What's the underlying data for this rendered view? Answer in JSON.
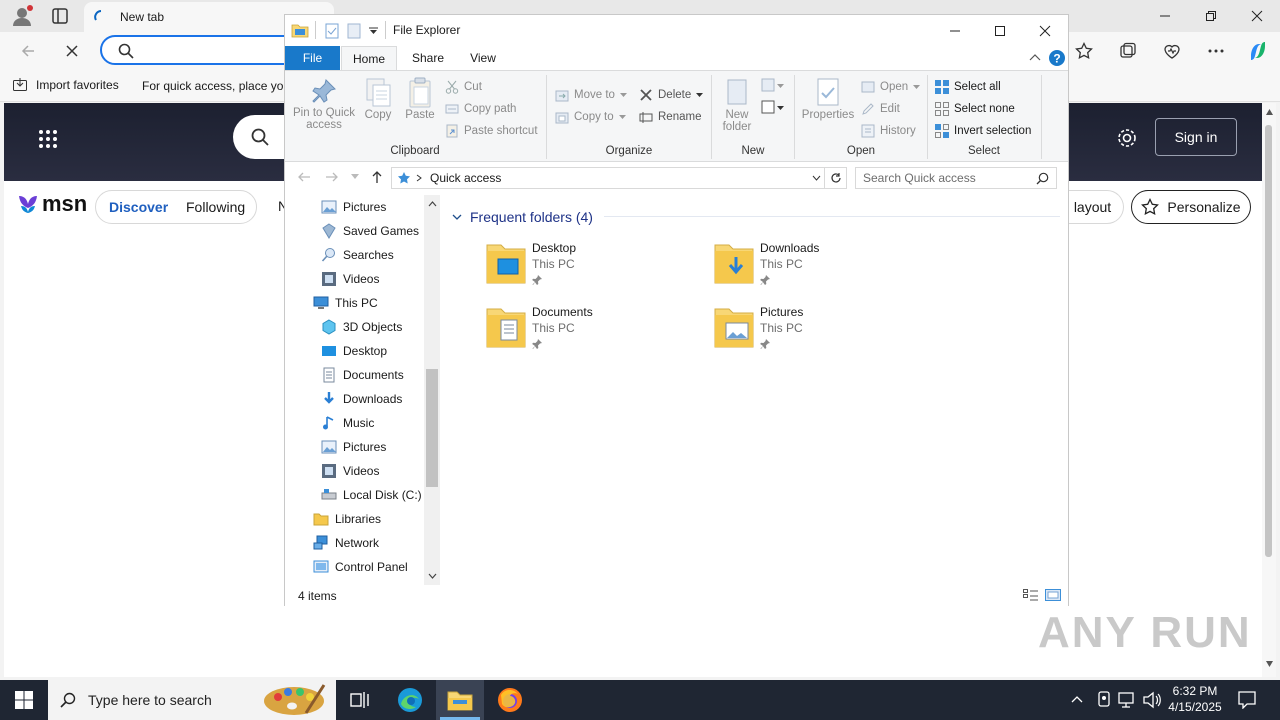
{
  "browser": {
    "tab_title": "New tab",
    "search_value": "",
    "favorites": {
      "import_label": "Import favorites",
      "hint_text": "For quick access, place you"
    }
  },
  "msn": {
    "logo_text": "msn",
    "nav": [
      "Discover",
      "Following",
      "N"
    ],
    "layout_label": "layout",
    "personalize_label": "Personalize",
    "sign_in_label": "Sign in"
  },
  "explorer": {
    "title": "File Explorer",
    "tabs": {
      "file": "File",
      "home": "Home",
      "share": "Share",
      "view": "View"
    },
    "ribbon": {
      "clipboard": {
        "pin": "Pin to Quick access",
        "copy": "Copy",
        "paste": "Paste",
        "cut": "Cut",
        "copy_path": "Copy path",
        "paste_shortcut": "Paste shortcut",
        "label": "Clipboard"
      },
      "organize": {
        "move_to": "Move to",
        "copy_to": "Copy to",
        "delete": "Delete",
        "rename": "Rename",
        "label": "Organize"
      },
      "new": {
        "new_folder_1": "New",
        "new_folder_2": "folder",
        "label": "New"
      },
      "open": {
        "properties": "Properties",
        "open": "Open",
        "edit": "Edit",
        "history": "History",
        "label": "Open"
      },
      "select": {
        "select_all": "Select all",
        "select_none": "Select none",
        "invert": "Invert selection",
        "label": "Select"
      }
    },
    "address": {
      "location": "Quick access",
      "search_placeholder": "Search Quick access"
    },
    "nav_items": [
      {
        "label": "Pictures",
        "icon": "pictures-icon"
      },
      {
        "label": "Saved Games",
        "icon": "saved-games-icon"
      },
      {
        "label": "Searches",
        "icon": "searches-icon"
      },
      {
        "label": "Videos",
        "icon": "videos-icon"
      },
      {
        "label": "This PC",
        "icon": "this-pc-icon"
      },
      {
        "label": "3D Objects",
        "icon": "3d-objects-icon"
      },
      {
        "label": "Desktop",
        "icon": "desktop-icon"
      },
      {
        "label": "Documents",
        "icon": "documents-icon"
      },
      {
        "label": "Downloads",
        "icon": "downloads-icon"
      },
      {
        "label": "Music",
        "icon": "music-icon"
      },
      {
        "label": "Pictures",
        "icon": "pictures-icon"
      },
      {
        "label": "Videos",
        "icon": "videos-icon"
      },
      {
        "label": "Local Disk (C:)",
        "icon": "local-disk-icon"
      },
      {
        "label": "Libraries",
        "icon": "libraries-icon"
      },
      {
        "label": "Network",
        "icon": "network-icon"
      },
      {
        "label": "Control Panel",
        "icon": "control-panel-icon"
      }
    ],
    "section_title": "Frequent folders (4)",
    "folders": [
      {
        "name": "Desktop",
        "location": "This PC"
      },
      {
        "name": "Downloads",
        "location": "This PC"
      },
      {
        "name": "Documents",
        "location": "This PC"
      },
      {
        "name": "Pictures",
        "location": "This PC"
      }
    ],
    "status": "4 items"
  },
  "taskbar": {
    "search_placeholder": "Type here to search",
    "time": "6:32 PM",
    "date": "4/15/2025"
  },
  "watermark": "ANY RUN",
  "colors": {
    "ribbon_file_blue": "#1979ca",
    "taskbar_bg": "#1f2633",
    "folder_yellow": "#f8d775",
    "accent_blue": "#0078d7"
  }
}
